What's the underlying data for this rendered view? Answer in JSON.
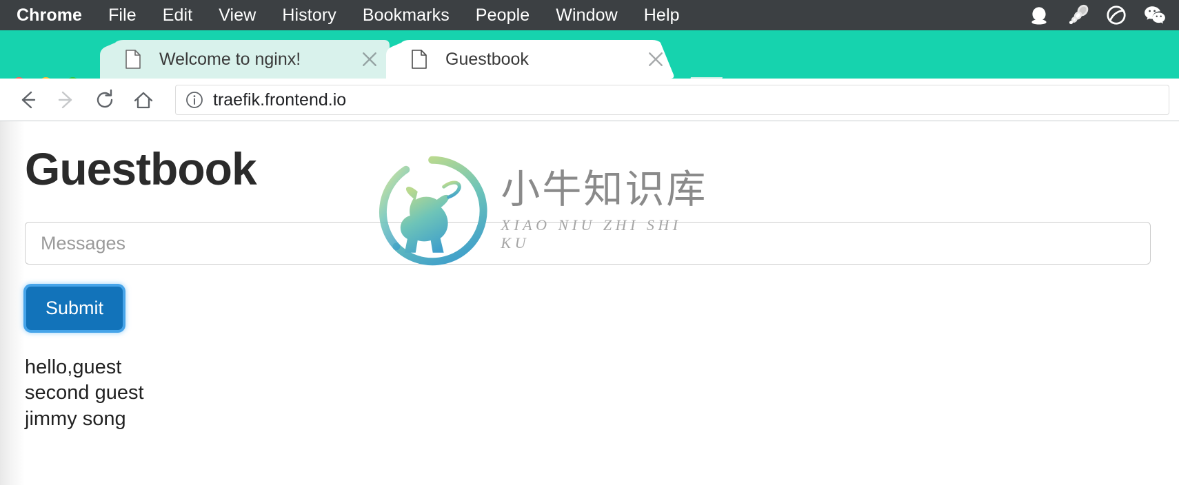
{
  "menubar": {
    "items": [
      {
        "label": "Chrome",
        "bold": true
      },
      {
        "label": "File",
        "bold": false
      },
      {
        "label": "Edit",
        "bold": false
      },
      {
        "label": "View",
        "bold": false
      },
      {
        "label": "History",
        "bold": false
      },
      {
        "label": "Bookmarks",
        "bold": false
      },
      {
        "label": "People",
        "bold": false
      },
      {
        "label": "Window",
        "bold": false
      },
      {
        "label": "Help",
        "bold": false
      }
    ],
    "status_icons": [
      "bowl-icon",
      "signal-icon",
      "circle-slash-icon",
      "wechat-icon"
    ],
    "background": "#3c4043"
  },
  "window": {
    "traffic_lights": [
      "close-red",
      "minimize-yellow",
      "maximize-green"
    ],
    "accent_color": "#16d3ae"
  },
  "tabs": [
    {
      "title": "Welcome to nginx!",
      "active": false,
      "favicon": "document-icon",
      "close": "close-icon"
    },
    {
      "title": "Guestbook",
      "active": true,
      "favicon": "document-icon",
      "close": "close-icon"
    }
  ],
  "new_tab": {
    "label": "new-tab-button"
  },
  "toolbar": {
    "back": "back-arrow-icon",
    "forward": "forward-arrow-icon",
    "reload": "reload-icon",
    "home": "home-icon",
    "security_icon": "info-circle-icon",
    "url": "traefik.frontend.io"
  },
  "page": {
    "title": "Guestbook",
    "input": {
      "placeholder": "Messages",
      "value": ""
    },
    "submit_label": "Submit",
    "messages": [
      "hello,guest",
      "second guest",
      "jimmy song"
    ]
  },
  "watermark": {
    "logo": "bull-circle-logo",
    "chinese": "小牛知识库",
    "pinyin": "XIAO NIU ZHI SHI KU",
    "gradient_from": "#a8d08d",
    "gradient_to": "#3aa7c7"
  }
}
